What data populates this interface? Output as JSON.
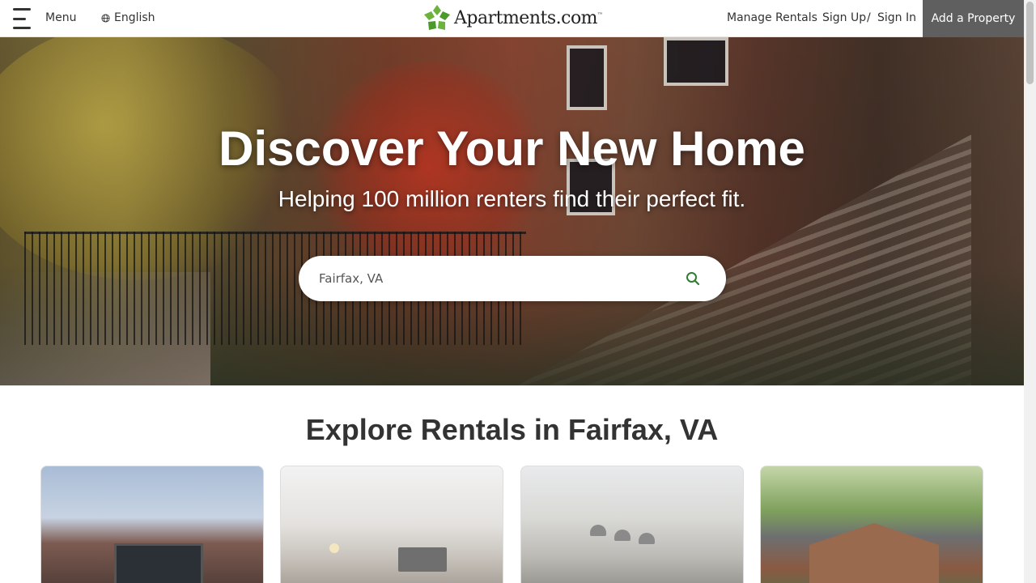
{
  "header": {
    "menu_label": "Menu",
    "language_label": "English",
    "logo_text": "Apartments.com",
    "logo_tm": "™",
    "manage_rentals": "Manage Rentals",
    "sign_up": "Sign Up",
    "separator": "/",
    "sign_in": "Sign In",
    "add_property": "Add a Property"
  },
  "hero": {
    "title": "Discover Your New Home",
    "subtitle": "Helping 100 million renters find their perfect fit.",
    "search_value": "Fairfax, VA"
  },
  "explore": {
    "title": "Explore Rentals in Fairfax, VA",
    "cards": [
      {
        "name": "rental-card-1"
      },
      {
        "name": "rental-card-2"
      },
      {
        "name": "rental-card-3"
      },
      {
        "name": "rental-card-4"
      }
    ]
  },
  "colors": {
    "brand_green": "#6cb33e",
    "add_property_bg": "#5f5f5f",
    "search_icon": "#2e7d32"
  },
  "icons": {
    "menu": "hamburger-icon",
    "language": "globe-icon",
    "search": "search-icon",
    "logo": "apartments-logo-icon"
  }
}
